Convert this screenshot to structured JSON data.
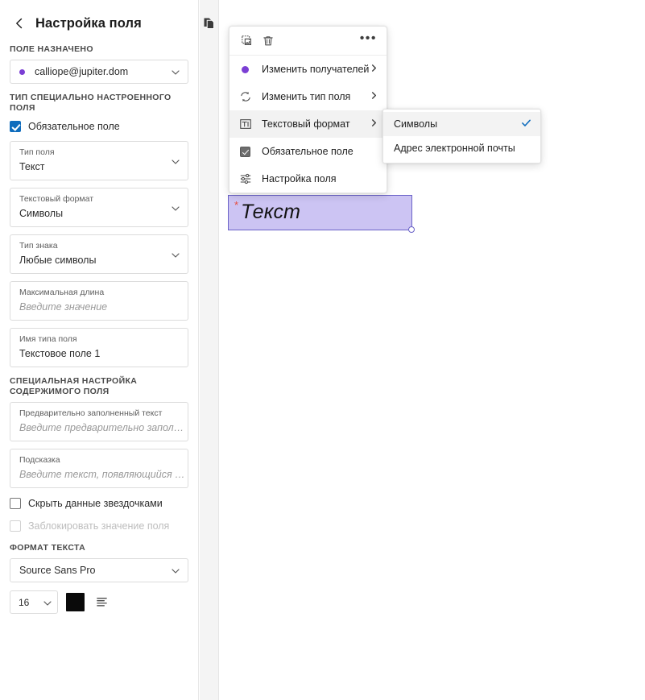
{
  "panel": {
    "title": "Настройка поля",
    "back_icon": "chevron-left-icon",
    "assigned_section_label": "ПОЛЕ НАЗНАЧЕНО",
    "assignee": {
      "value": "calliope@jupiter.dom",
      "dot_color": "#7b3fd4"
    },
    "custom_type_section_label": "ТИП СПЕЦИАЛЬНО НАСТРОЕННОГО ПОЛЯ",
    "required_checkbox": {
      "label": "Обязательное поле",
      "checked": true
    },
    "fields": [
      {
        "label": "Тип поля",
        "value": "Текст",
        "is_placeholder": false,
        "has_chevron": true
      },
      {
        "label": "Текстовый формат",
        "value": "Символы",
        "is_placeholder": false,
        "has_chevron": true
      },
      {
        "label": "Тип знака",
        "value": "Любые символы",
        "is_placeholder": false,
        "has_chevron": true
      },
      {
        "label": "Максимальная длина",
        "value": "Введите значение",
        "is_placeholder": true,
        "has_chevron": false
      },
      {
        "label": "Имя типа поля",
        "value": "Текстовое поле 1",
        "is_placeholder": false,
        "has_chevron": false
      }
    ],
    "content_section_label": "СПЕЦИАЛЬНАЯ НАСТРОЙКА СОДЕРЖИМОГО ПОЛЯ",
    "content_fields": [
      {
        "label": "Предварительно заполненный текст",
        "value": "Введите предварительно запол…",
        "is_placeholder": true
      },
      {
        "label": "Подсказка",
        "value": "Введите текст, появляющийся …",
        "is_placeholder": true
      }
    ],
    "hide_data_checkbox": {
      "label": "Скрыть данные звездочками",
      "checked": false,
      "disabled": false
    },
    "lock_value_checkbox": {
      "label": "Заблокировать значение поля",
      "checked": false,
      "disabled": true
    },
    "text_format_section_label": "ФОРМАТ ТЕКСТА",
    "font_family": "Source Sans Pro",
    "font_size": "16",
    "font_color": "#0a0a0a",
    "align_icon": "align-left-icon"
  },
  "toolstrip": {
    "pages_icon": "pages-copy-icon"
  },
  "canvas": {
    "doc_field": {
      "required_marker": "*",
      "text": "Текст",
      "fill_color": "#ccc4f3",
      "border_color": "#6b63c8",
      "resize_handle": "resize-handle"
    }
  },
  "context_menu": {
    "toolbar": {
      "duplicate_icon": "duplicate-icon",
      "delete_icon": "trash-icon",
      "more_label": "•••"
    },
    "items": [
      {
        "label": "Изменить получателей",
        "icon": "recipient-dot-icon",
        "has_submenu": true,
        "active": false
      },
      {
        "label": "Изменить тип поля",
        "icon": "sync-icon",
        "has_submenu": true,
        "active": false
      },
      {
        "label": "Текстовый формат",
        "icon": "text-format-icon",
        "has_submenu": true,
        "active": true
      },
      {
        "label": "Обязательное поле",
        "icon": "checked-box-icon",
        "has_submenu": false,
        "active": false
      },
      {
        "label": "Настройка поля",
        "icon": "sliders-icon",
        "has_submenu": false,
        "active": false
      }
    ]
  },
  "submenu": {
    "items": [
      {
        "label": "Символы",
        "selected": true,
        "check_icon": "check-icon"
      },
      {
        "label": "Адрес электронной почты",
        "selected": false,
        "check_icon": ""
      }
    ]
  }
}
